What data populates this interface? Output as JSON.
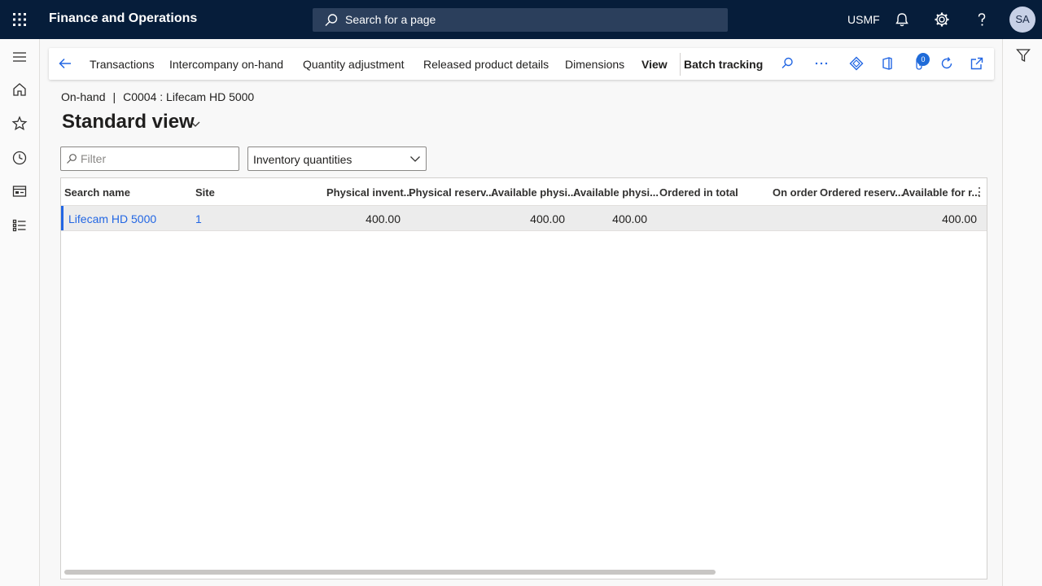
{
  "topbar": {
    "app_title": "Finance and Operations",
    "search_placeholder": "Search for a page",
    "company": "USMF",
    "avatar_initials": "SA",
    "icons": [
      "app-launcher-icon",
      "search-icon",
      "bell-icon",
      "gear-icon",
      "help-icon"
    ]
  },
  "left_nav": {
    "icons": [
      "hamburger-icon",
      "home-icon",
      "star-icon",
      "clock-icon",
      "workspaces-icon",
      "modules-icon"
    ]
  },
  "right_pane": {
    "icons": [
      "filter-icon"
    ]
  },
  "action_pane": {
    "items": [
      "Transactions",
      "Intercompany on-hand",
      "Quantity adjustment",
      "Released product details",
      "Dimensions",
      "View",
      "Batch tracking"
    ],
    "attachments_count": "0",
    "icons": [
      "back-arrow-icon",
      "search-icon",
      "more-icon",
      "power-apps-icon",
      "office-icon",
      "attachment-icon",
      "refresh-icon",
      "open-new-window-icon"
    ]
  },
  "breadcrumb": {
    "page": "On-hand",
    "separator": "|",
    "record": "C0004 : Lifecam HD 5000"
  },
  "view": {
    "title": "Standard view"
  },
  "filter": {
    "placeholder": "Filter"
  },
  "select": {
    "value": "Inventory quantities"
  },
  "grid": {
    "columns": [
      "Search name",
      "Site",
      "Physical invent...",
      "Physical reserv...",
      "Available physi...",
      "Available physi...",
      "Ordered in total",
      "On order",
      "Ordered reserv...",
      "Available for r..."
    ],
    "rows": [
      [
        "Lifecam HD 5000",
        "1",
        "400.00",
        "",
        "400.00",
        "400.00",
        "",
        "",
        "",
        "400.00"
      ]
    ]
  },
  "colors": {
    "topbar_bg": "#061d3a",
    "link": "#2266e3",
    "selected_row": "#ececec"
  }
}
